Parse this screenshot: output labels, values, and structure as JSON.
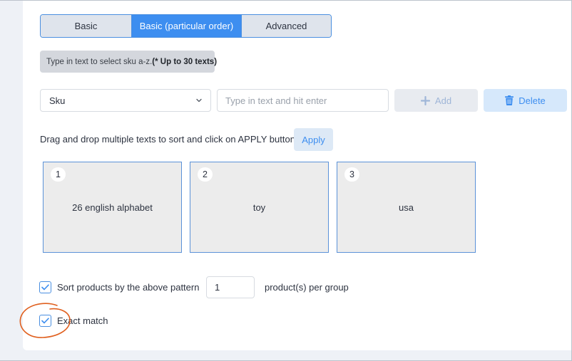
{
  "tabs": [
    {
      "label": "Basic",
      "active": false
    },
    {
      "label": "Basic (particular order)",
      "active": true
    },
    {
      "label": "Advanced",
      "active": false
    }
  ],
  "hint": {
    "text": "Type in text to select sku a-z.",
    "bold": "(* Up to 30 texts)"
  },
  "field_select": {
    "value": "Sku",
    "icon": "chevron-down-icon"
  },
  "text_input": {
    "placeholder": "Type in text and hit enter",
    "value": ""
  },
  "add_button": {
    "label": "Add",
    "icon": "plus-icon",
    "enabled": false
  },
  "delete_button": {
    "label": "Delete",
    "icon": "trash-icon"
  },
  "instruction": "Drag and drop multiple texts to sort and click on APPLY button",
  "apply_button": {
    "label": "Apply"
  },
  "sort_items": [
    {
      "index": "1",
      "text": "26 english alphabet"
    },
    {
      "index": "2",
      "text": "toy"
    },
    {
      "index": "3",
      "text": "usa"
    }
  ],
  "sort_pattern": {
    "checked": true,
    "label": "Sort products by the above pattern",
    "per_group_value": "1",
    "per_group_suffix": "product(s) per group"
  },
  "exact_match": {
    "checked": true,
    "label": "Exact match"
  },
  "colors": {
    "accent": "#3d8ef0",
    "annotation": "#e0601f",
    "card_bg": "#ececec",
    "card_border": "#5b92d8"
  }
}
